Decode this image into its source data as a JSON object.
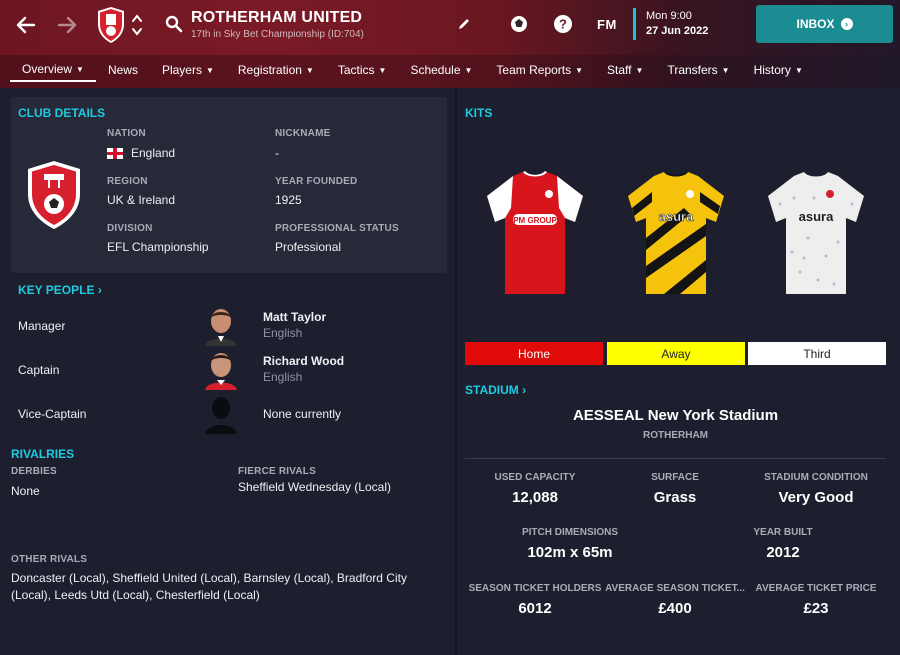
{
  "header": {
    "club_name": "ROTHERHAM UNITED",
    "club_sub": "17th in Sky Bet Championship (ID:704)",
    "fm_label": "FM",
    "day_time": "Mon 9:00",
    "date": "27 Jun 2022",
    "inbox_label": "INBOX"
  },
  "tabs": [
    {
      "label": "Overview",
      "dropdown": true,
      "active": true
    },
    {
      "label": "News",
      "dropdown": false
    },
    {
      "label": "Players",
      "dropdown": true
    },
    {
      "label": "Registration",
      "dropdown": true
    },
    {
      "label": "Tactics",
      "dropdown": true
    },
    {
      "label": "Schedule",
      "dropdown": true
    },
    {
      "label": "Team Reports",
      "dropdown": true
    },
    {
      "label": "Staff",
      "dropdown": true
    },
    {
      "label": "Transfers",
      "dropdown": true
    },
    {
      "label": "History",
      "dropdown": true
    }
  ],
  "club_details": {
    "title": "CLUB DETAILS",
    "nation_label": "NATION",
    "nation": "England",
    "nickname_label": "NICKNAME",
    "nickname": "-",
    "region_label": "REGION",
    "region": "UK & Ireland",
    "founded_label": "YEAR FOUNDED",
    "founded": "1925",
    "division_label": "DIVISION",
    "division": "EFL Championship",
    "status_label": "PROFESSIONAL STATUS",
    "status": "Professional"
  },
  "key_people": {
    "title": "KEY PEOPLE",
    "rows": [
      {
        "role": "Manager",
        "name": "Matt Taylor",
        "nationality": "English"
      },
      {
        "role": "Captain",
        "name": "Richard Wood",
        "nationality": "English"
      },
      {
        "role": "Vice-Captain",
        "name": "None currently",
        "nationality": ""
      }
    ]
  },
  "rivalries": {
    "title": "RIVALRIES",
    "derbies_label": "DERBIES",
    "derbies": "None",
    "fierce_label": "FIERCE RIVALS",
    "fierce": "Sheffield Wednesday (Local)",
    "other_label": "OTHER RIVALS",
    "other_line1": "Doncaster (Local), Sheffield United (Local), Barnsley (Local), Bradford City",
    "other_line2": "(Local), Leeds Utd (Local), Chesterfield (Local)"
  },
  "kits": {
    "title": "KITS",
    "home_label": "Home",
    "away_label": "Away",
    "third_label": "Third",
    "home_sponsor": "PM GROUP",
    "away_sponsor": "asura",
    "third_sponsor": "asura",
    "colors": {
      "home": "#e00a0a",
      "away": "#ffff00",
      "third": "#ffffff"
    }
  },
  "stadium": {
    "title": "STADIUM",
    "name": "AESSEAL New York Stadium",
    "city": "ROTHERHAM",
    "used_capacity_label": "USED CAPACITY",
    "used_capacity": "12,088",
    "surface_label": "SURFACE",
    "surface": "Grass",
    "condition_label": "STADIUM CONDITION",
    "condition": "Very Good",
    "pitch_label": "PITCH DIMENSIONS",
    "pitch": "102m x 65m",
    "built_label": "YEAR BUILT",
    "built": "2012",
    "holders_label": "SEASON TICKET HOLDERS",
    "holders": "6012",
    "avg_season_label": "AVERAGE SEASON TICKET...",
    "avg_season": "£400",
    "avg_ticket_label": "AVERAGE TICKET PRICE",
    "avg_ticket": "£23"
  },
  "accent_color": "#1ecbe1"
}
